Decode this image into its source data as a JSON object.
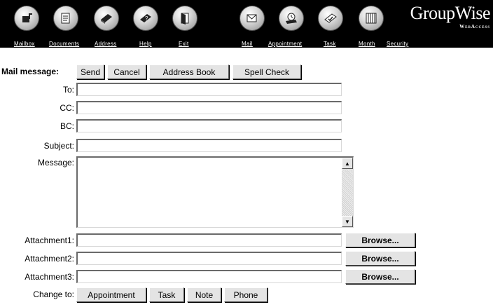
{
  "nav": {
    "links": [
      "Mailbox",
      "Documents",
      "Address",
      "Help",
      "Exit",
      "Mail",
      "Appointment",
      "Task",
      "Month",
      "Security"
    ],
    "icons": [
      "mailbox-icon",
      "documents-icon",
      "address-icon",
      "help-icon",
      "exit-icon",
      "mail-icon",
      "appointment-icon",
      "task-icon",
      "month-icon"
    ],
    "logo_main": "GroupWise",
    "logo_sub": "WebAccess"
  },
  "form": {
    "title": "Mail message:",
    "actions": {
      "send": "Send",
      "cancel": "Cancel",
      "address_book": "Address Book",
      "spell_check": "Spell Check"
    },
    "labels": {
      "to": "To:",
      "cc": "CC:",
      "bc": "BC:",
      "subject": "Subject:",
      "message": "Message:",
      "attachment1": "Attachment1:",
      "attachment2": "Attachment2:",
      "attachment3": "Attachment3:",
      "change_to": "Change to:"
    },
    "values": {
      "to": "",
      "cc": "",
      "bc": "",
      "subject": "",
      "message": "",
      "attachment1": "",
      "attachment2": "",
      "attachment3": ""
    },
    "browse": "Browse...",
    "change_options": {
      "appointment": "Appointment",
      "task": "Task",
      "note": "Note",
      "phone": "Phone"
    }
  }
}
